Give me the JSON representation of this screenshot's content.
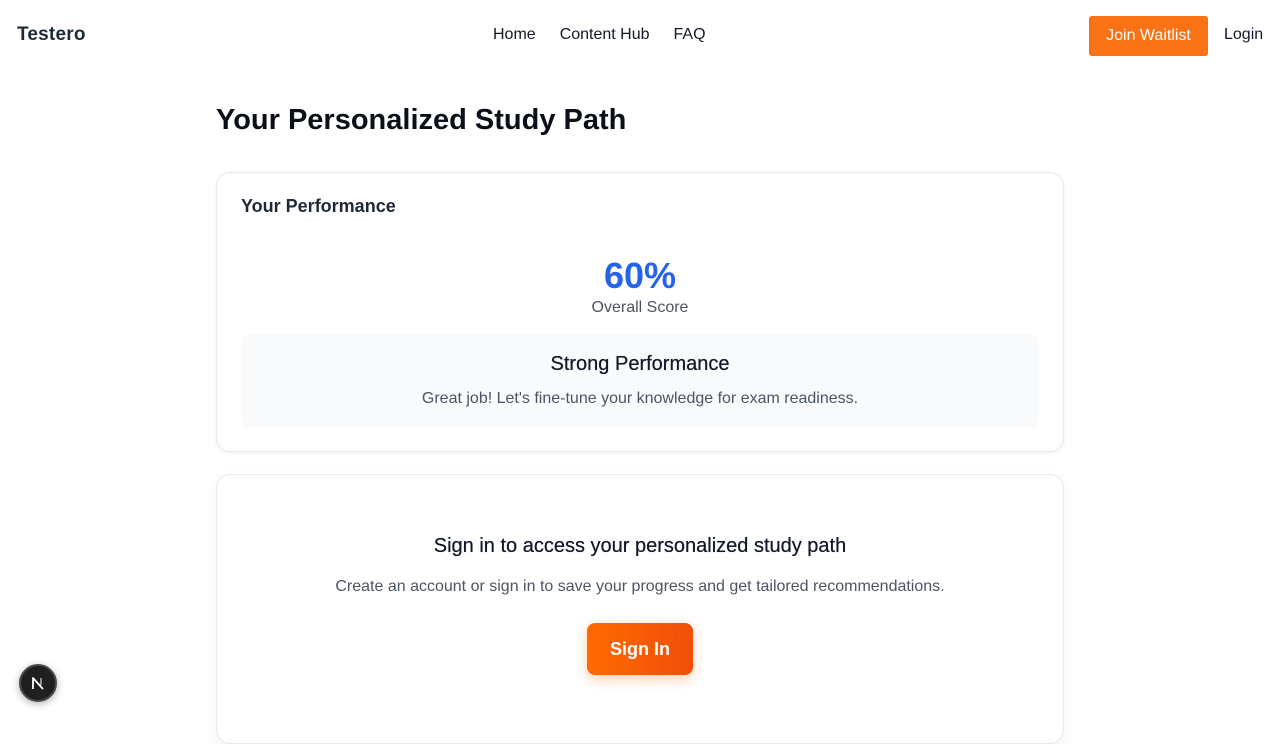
{
  "header": {
    "brand": "Testero",
    "nav": [
      "Home",
      "Content Hub",
      "FAQ"
    ],
    "join_label": "Join Waitlist",
    "login_label": "Login"
  },
  "main": {
    "title": "Your Personalized Study Path",
    "performance": {
      "heading": "Your Performance",
      "score": "60%",
      "score_label": "Overall Score",
      "status_title": "Strong Performance",
      "status_text": "Great job! Let's fine-tune your knowledge for exam readiness."
    },
    "signin": {
      "title": "Sign in to access your personalized study path",
      "text": "Create an account or sign in to save your progress and get tailored recommendations.",
      "button_label": "Sign In"
    }
  },
  "floating_button": {
    "icon": "next-logo-icon"
  },
  "colors": {
    "accent": "#f97316",
    "score": "#2563eb"
  }
}
